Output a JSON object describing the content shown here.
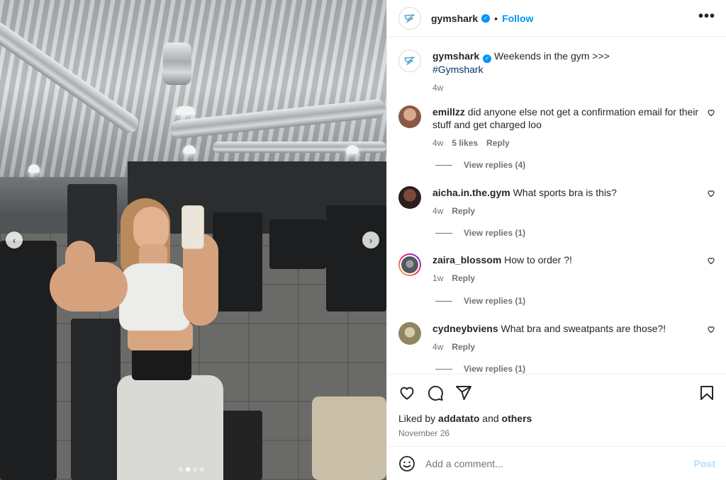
{
  "header": {
    "username": "gymshark",
    "separator": "•",
    "follow_label": "Follow",
    "more_label": "•••"
  },
  "caption": {
    "username": "gymshark",
    "text": "Weekends in the gym >>>",
    "hashtag": "#Gymshark",
    "time": "4w"
  },
  "comments": [
    {
      "username": "emillzz",
      "text": "did anyone else not get a confirmation email for their stuff and get charged loo",
      "time": "4w",
      "likes": "5 likes",
      "reply": "Reply",
      "view_replies": "View replies (4)",
      "avatar_color": "#a8705a"
    },
    {
      "username": "aicha.in.the.gym",
      "text": "What sports bra is this?",
      "time": "4w",
      "reply": "Reply",
      "view_replies": "View replies (1)",
      "avatar_color": "#3b2a24"
    },
    {
      "username": "zaira_blossom",
      "text": "How to order ?!",
      "time": "1w",
      "reply": "Reply",
      "view_replies": "View replies (1)",
      "avatar_color": "#6a6d72"
    },
    {
      "username": "cydneybviens",
      "text": "What bra and sweatpants are those?!",
      "time": "4w",
      "reply": "Reply",
      "view_replies": "View replies (1)",
      "avatar_color": "#b0a078"
    }
  ],
  "liked_by": {
    "prefix": "Liked by",
    "user": "addatato",
    "and": "and",
    "others": "others"
  },
  "post_date": "November 26",
  "add_comment": {
    "placeholder": "Add a comment...",
    "post_label": "Post"
  },
  "colors": {
    "accent": "#0095f6",
    "brand_logo": "#4ea7c9"
  }
}
